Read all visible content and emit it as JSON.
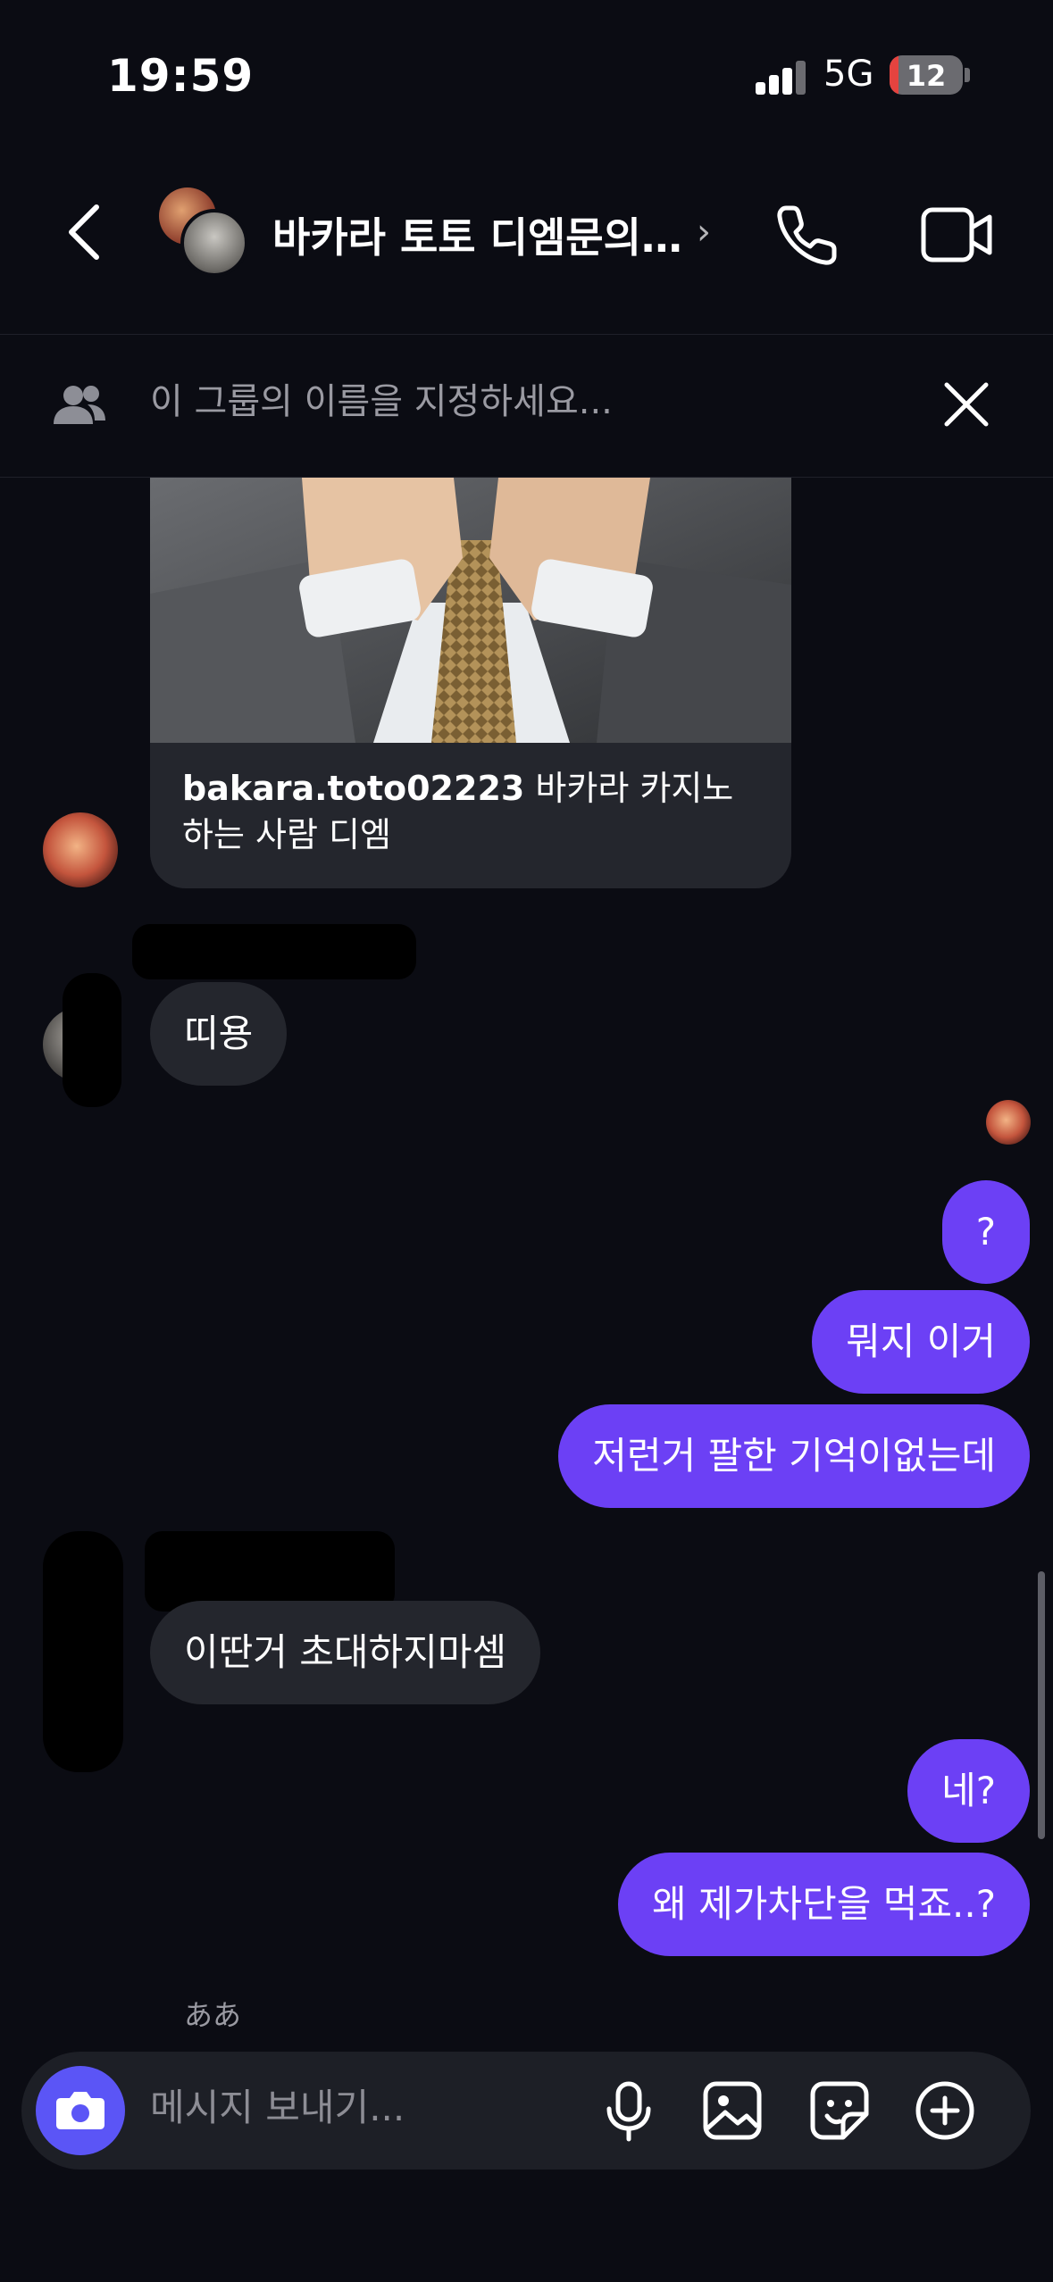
{
  "status_bar": {
    "time": "19:59",
    "network": "5G",
    "battery": "12",
    "battery_level": 0.12
  },
  "header": {
    "title": "바카라 토토 디엠문의.…",
    "chevron": "›"
  },
  "banner": {
    "placeholder": "이 그룹의 이름을 지정하세요..."
  },
  "shared_post": {
    "username": "bakara.toto02223",
    "caption_rest": " 바카라 카지노하는 사람 디엠"
  },
  "messages": [
    {
      "side": "in",
      "text": "띠용"
    },
    {
      "side": "out",
      "text": "?"
    },
    {
      "side": "out",
      "text": "뭐지 이거"
    },
    {
      "side": "out",
      "text": "저런거 팔한 기억이없는데"
    },
    {
      "side": "in",
      "text": "이딴거 초대하지마셈"
    },
    {
      "side": "out",
      "text": "네?"
    },
    {
      "side": "out",
      "text": "왜 제가차단을 먹죠..?"
    }
  ],
  "last_sender_label": "ああ",
  "composer": {
    "placeholder": "메시지 보내기..."
  },
  "colors": {
    "background": "#0b0c13",
    "bubble_out": "#6c40f5",
    "bubble_in": "#24262d",
    "camera": "#5b55f6"
  }
}
